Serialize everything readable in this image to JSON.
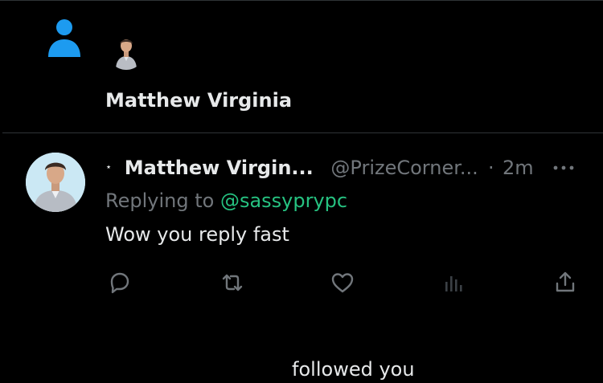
{
  "notification": {
    "name": "Matthew Virginia",
    "action": "followed you",
    "icon": "person-icon",
    "icon_color": "#1d9bf0"
  },
  "tweet": {
    "author_name": "Matthew Virgin...",
    "handle": "@PrizeCorner...",
    "separator": "·",
    "time": "2m",
    "reply_prefix": "Replying to",
    "reply_handle": "@sassyprypc",
    "text": "Wow you reply fast",
    "verified_marker": "⋆"
  },
  "actions": [
    "reply-icon",
    "retweet-icon",
    "like-icon",
    "views-icon",
    "share-icon"
  ],
  "colors": {
    "background": "#000000",
    "text": "#e7e9ea",
    "muted": "#71767b",
    "link": "#26c281",
    "accent": "#1d9bf0",
    "divider": "#2f3336"
  }
}
